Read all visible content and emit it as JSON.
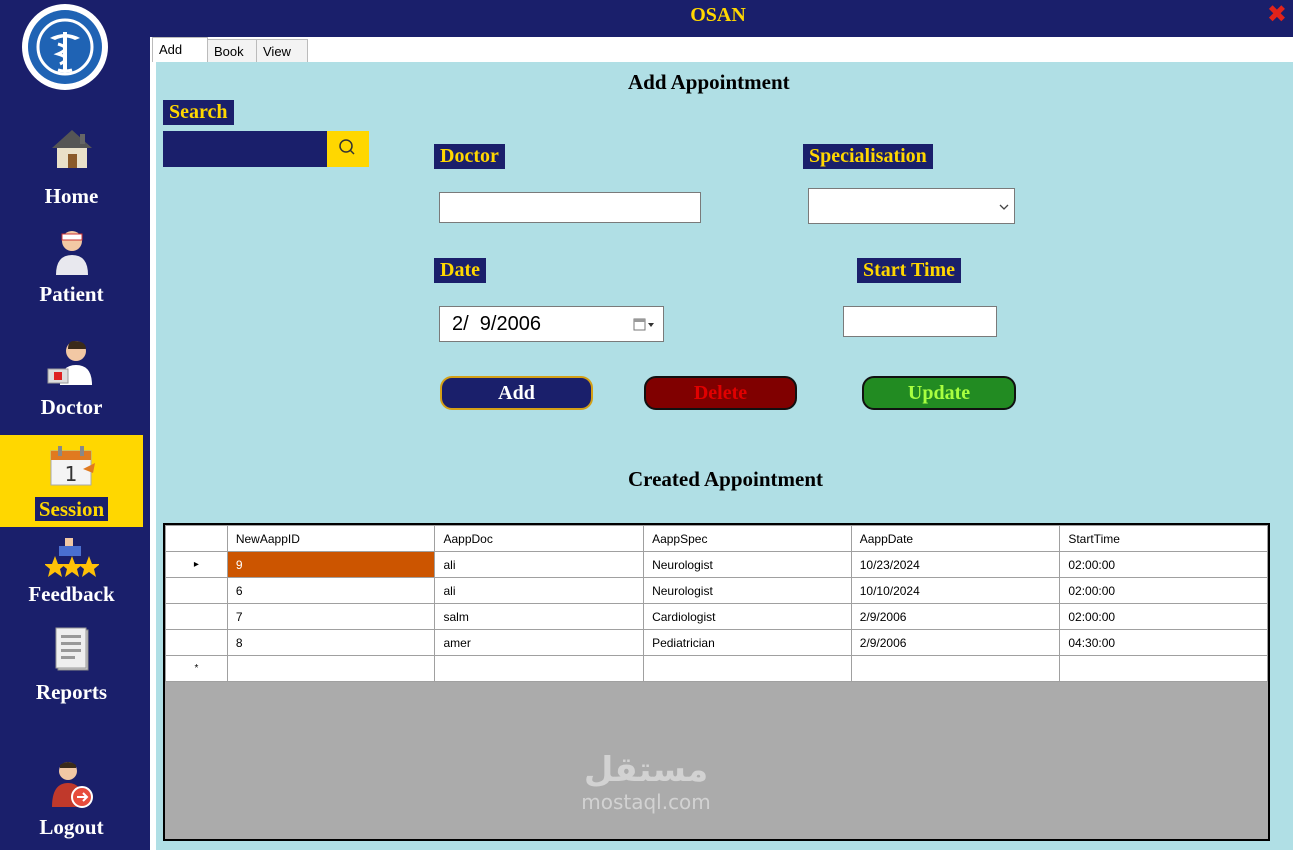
{
  "window": {
    "title": "OSAN",
    "close_icon": "close-icon"
  },
  "sidebar": {
    "logo_icon": "pharmacy-caduceus-icon",
    "items": [
      {
        "label": "Home",
        "icon": "home-icon",
        "active": false
      },
      {
        "label": "Patient",
        "icon": "patient-icon",
        "active": false
      },
      {
        "label": "Doctor",
        "icon": "doctor-icon",
        "active": false
      },
      {
        "label": "Session",
        "icon": "calendar-icon",
        "active": true
      },
      {
        "label": "Feedback",
        "icon": "feedback-stars-icon",
        "active": false
      },
      {
        "label": "Reports",
        "icon": "report-icon",
        "active": false
      },
      {
        "label": "Logout",
        "icon": "logout-icon",
        "active": false
      }
    ]
  },
  "tabs": [
    {
      "label": "Add",
      "active": true
    },
    {
      "label": "Book",
      "active": false
    },
    {
      "label": "View",
      "active": false
    }
  ],
  "form": {
    "heading": "Add Appointment",
    "search_label": "Search",
    "search_value": "",
    "doctor_label": "Doctor",
    "doctor_value": "",
    "specialisation_label": "Specialisation",
    "specialisation_value": "",
    "date_label": "Date",
    "date_value": "2/  9/2006",
    "start_time_label": "Start Time",
    "start_time_value": "",
    "add_label": "Add",
    "delete_label": "Delete",
    "update_label": "Update"
  },
  "table": {
    "heading": "Created Appointment",
    "columns": [
      "NewAappID",
      "AappDoc",
      "AappSpec",
      "AappDate",
      "StartTime"
    ],
    "rows": [
      [
        "9",
        "ali",
        "Neurologist",
        "10/23/2024",
        "02:00:00"
      ],
      [
        "6",
        "ali",
        "Neurologist",
        "10/10/2024",
        "02:00:00"
      ],
      [
        "7",
        "salm",
        "Cardiologist",
        "2/9/2006",
        "02:00:00"
      ],
      [
        "8",
        "amer",
        "Pediatrician",
        "2/9/2006",
        "04:30:00"
      ]
    ],
    "selected_row_marker": "▸",
    "new_row_marker": "*"
  },
  "watermark": {
    "arabic": "مستقل",
    "latin": "mostaql.com"
  },
  "colors": {
    "navy": "#1a1f6b",
    "gold": "#ffd700",
    "panel": "#b0dfe5",
    "delete": "#800000",
    "update": "#228b22",
    "selected_cell": "#cc5500"
  }
}
